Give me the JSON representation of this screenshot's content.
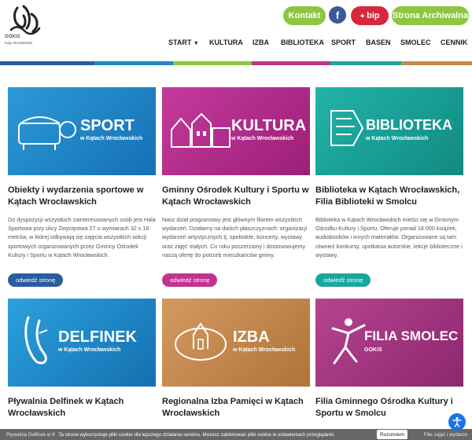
{
  "header": {
    "logo_text_1": "GOKiS",
    "logo_text_2": "Kąty Wrocławskie",
    "kontakt_label": "Kontakt",
    "fb_label": "f",
    "bip_label": "bip",
    "archive_label": "Strona Archiwalna",
    "nav": [
      {
        "label": "START"
      },
      {
        "label": "KULTURA"
      },
      {
        "label": "IZBA"
      },
      {
        "label": "BIBLIOTEKA"
      },
      {
        "label": "SPORT"
      },
      {
        "label": "BASEN"
      },
      {
        "label": "SMOLEC"
      },
      {
        "label": "CENNIK"
      }
    ],
    "nav_caret": "▼"
  },
  "colors": {
    "green": "#8dc63f",
    "sport": "#1e88c9",
    "kultura": "#b8278e",
    "biblioteka": "#1aa79e",
    "delfinek": "#1f8fcf",
    "izba": "#c98a4e",
    "smolec": "#a3357f",
    "btn_sport": "#2a5d9f",
    "btn_kultura": "#c2338f",
    "btn_biblioteka": "#1aa79e",
    "rainbow": [
      "#2a5d9f",
      "#1e88c9",
      "#8dc63f",
      "#c2338f",
      "#1aa79e",
      "#c98a4e"
    ]
  },
  "cards": [
    {
      "brand": "SPORT",
      "brand_sub": "w Kątach Wrocławskich",
      "title": "Obiekty i wydarzenia sportowe w Kątach Wrocławskich",
      "desc": "Do dyspozycji wszystkich zainteresowanych osób jest Hala Sportowa przy ulicy Zwycięstwa 27 o wymiarach 32 x 16 metrów, w której odbywają się zajęcia wszystkich sekcji sportowych organizowanych przez Gminny Ośrodek Kultury i Sportu w Kątach Wrocławskich.",
      "button": "odwiedź stronę"
    },
    {
      "brand": "KULTURA",
      "brand_sub": "w Kątach Wrocławskich",
      "title": "Gminny Ośrodek Kultury i Sportu w Kątach Wrocławskich",
      "desc": "Nasz dział programowy jest głównym filarem wszystkich wydarzeń. Działamy na dwóch płaszczyznach: organizacji wydarzeń artystycznych tj. spektakle, koncerty, wystawy oraz zajęć stałych. Co roku poszerzamy i dostosowujemy naszą ofertę do potrzeb mieszkańców gminy.",
      "button": "odwiedź stronę"
    },
    {
      "brand": "BIBLIOTEKA",
      "brand_sub": "w Kątach Wrocławskich",
      "title": "Biblioteka w Kątach Wrocławskich, Filia Biblioteki w Smolcu",
      "desc": "Biblioteka w Kątach Wrocławskich mieści się w Gminnym Ośrodku Kultury i Sportu. Oferuje ponad 18 000 książek, audiobooków i innych materiałów. Organizowane są tam również konkursy, spotkania autorskie, lekcje biblioteczne i wystawy.",
      "button": "odwiedź stronę"
    },
    {
      "brand": "DELFINEK",
      "brand_sub": "w Kątach Wrocławskich",
      "title": "Pływalnia Delfinek w Kątach Wrocławskich"
    },
    {
      "brand": "IZBA",
      "brand_sub": "w Kątach Wrocławskich",
      "title": "Regionalna Izba Pamięci w Kątach Wrocławskich"
    },
    {
      "brand": "FILIA SMOLEC",
      "brand_sub": "GOKiS",
      "title": "Filia Gminnego Ośrodka Kultury i Sportu w Smolcu"
    }
  ],
  "cookie": {
    "partial_left": "Pływalnia Delfinek w K",
    "text": "Ta strona wykorzystuje pliki cookie dla lepszego działania serwisu. Możesz zablokować pliki cookie w ustawieniach przeglądarki.",
    "button": "Rozumiem",
    "partial_right": "Filie zajęć i wydarze"
  },
  "a11y_icon": "accessibility-icon"
}
